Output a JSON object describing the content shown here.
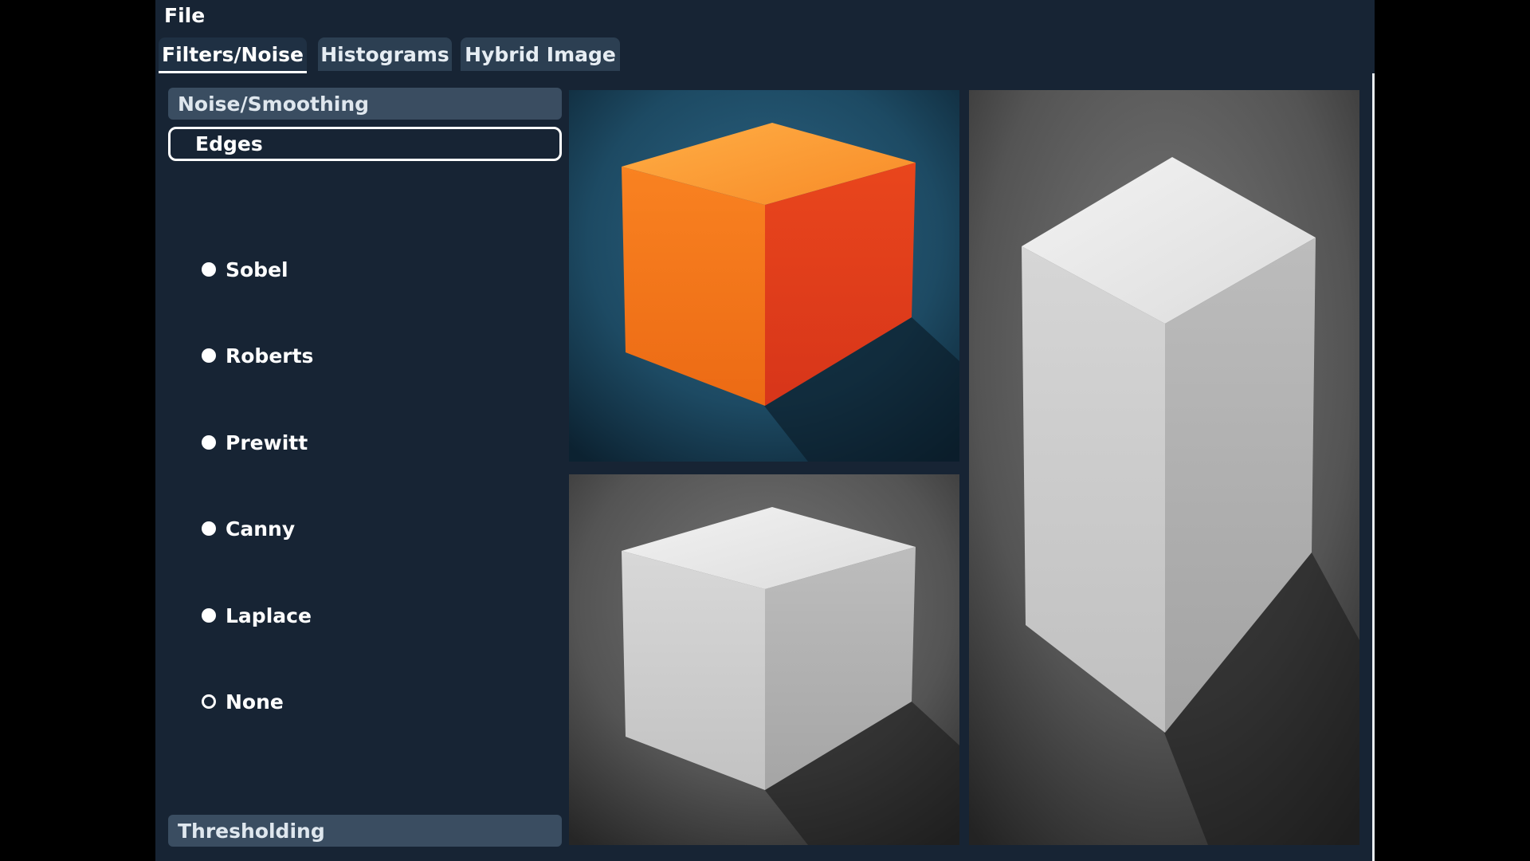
{
  "menubar": {
    "file": "File"
  },
  "tabs": [
    {
      "label": "Filters/Noise",
      "active": true
    },
    {
      "label": "Histograms",
      "active": false
    },
    {
      "label": "Hybrid Image",
      "active": false
    }
  ],
  "sidebar": {
    "noise_smoothing": "Noise/Smoothing",
    "edges": "Edges",
    "thresholding": "Thresholding",
    "edge_options": [
      {
        "label": "Sobel",
        "selected": false
      },
      {
        "label": "Roberts",
        "selected": false
      },
      {
        "label": "Prewitt",
        "selected": false
      },
      {
        "label": "Canny",
        "selected": false
      },
      {
        "label": "Laplace",
        "selected": false
      },
      {
        "label": "None",
        "selected": true
      }
    ]
  },
  "images": {
    "original": "orange cube on blue background",
    "grayscale": "grayscale cube",
    "output": "grayscale cube output"
  },
  "colors": {
    "panel_bg": "#172434",
    "header_bg": "#3a4d61",
    "cube_orange": "#f2761f",
    "cube_red": "#e0401d",
    "blue_bg": "#1d4a63"
  }
}
